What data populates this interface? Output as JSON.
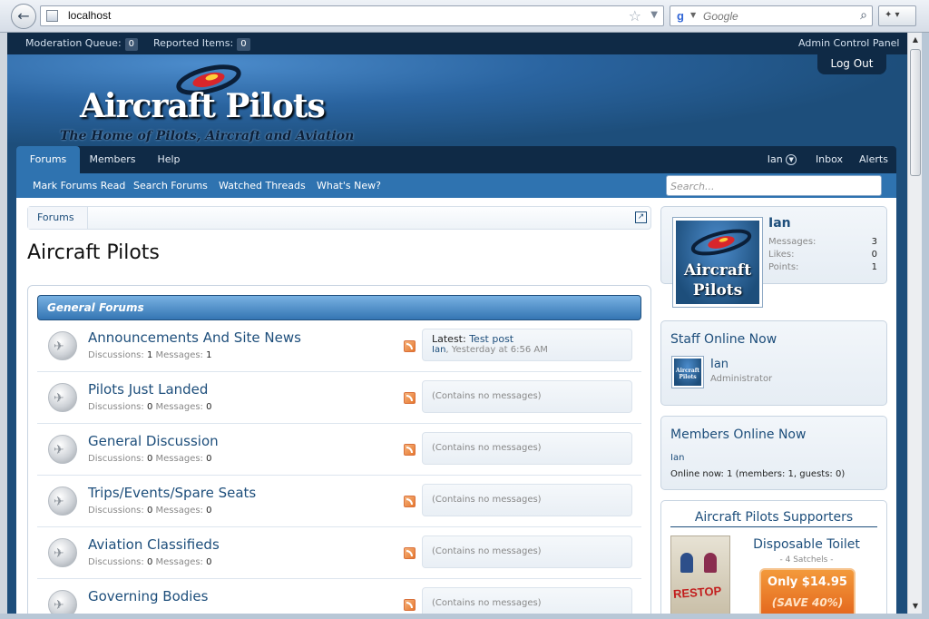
{
  "browser": {
    "url": "localhost",
    "search_placeholder": "Google"
  },
  "admin_bar": {
    "moderation_label": "Moderation Queue:",
    "moderation_count": "0",
    "reported_label": "Reported Items:",
    "reported_count": "0",
    "acp_label": "Admin Control Panel"
  },
  "header": {
    "logout_label": "Log Out",
    "logo_text": "Aircraft Pilots",
    "tagline": "The Home of Pilots, Aircraft and Aviation"
  },
  "nav": {
    "tabs": [
      {
        "label": "Forums",
        "active": true
      },
      {
        "label": "Members"
      },
      {
        "label": "Help"
      }
    ],
    "user": "Ian",
    "inbox": "Inbox",
    "alerts": "Alerts"
  },
  "subnav": {
    "links": [
      "Mark Forums Read",
      "Search Forums",
      "Watched Threads",
      "What's New?"
    ],
    "search_placeholder": "Search..."
  },
  "breadcrumb": {
    "item": "Forums"
  },
  "page_title": "Aircraft Pilots",
  "category": {
    "title": "General Forums"
  },
  "stats_labels": {
    "discussions": "Discussions:",
    "messages": "Messages:"
  },
  "forums": [
    {
      "title": "Announcements And Site News",
      "discussions": "1",
      "messages": "1",
      "latest_label": "Latest:",
      "latest_title": "Test post",
      "latest_user": "Ian",
      "latest_time": ", Yesterday at 6:56 AM"
    },
    {
      "title": "Pilots Just Landed",
      "discussions": "0",
      "messages": "0",
      "empty": "(Contains no messages)"
    },
    {
      "title": "General Discussion",
      "discussions": "0",
      "messages": "0",
      "empty": "(Contains no messages)"
    },
    {
      "title": "Trips/Events/Spare Seats",
      "discussions": "0",
      "messages": "0",
      "empty": "(Contains no messages)"
    },
    {
      "title": "Aviation Classifieds",
      "discussions": "0",
      "messages": "0",
      "empty": "(Contains no messages)"
    },
    {
      "title": "Governing Bodies",
      "empty": "(Contains no messages)"
    }
  ],
  "sidebar": {
    "visitor": {
      "avatar_text": "Aircraft Pilots",
      "name": "Ian",
      "stats": [
        {
          "label": "Messages:",
          "value": "3"
        },
        {
          "label": "Likes:",
          "value": "0"
        },
        {
          "label": "Points:",
          "value": "1"
        }
      ]
    },
    "staff": {
      "title": "Staff Online Now",
      "avatar_text": "Aircraft Pilots",
      "name": "Ian",
      "role": "Administrator"
    },
    "members": {
      "title": "Members Online Now",
      "member": "Ian",
      "online": "Online now: 1 (members: 1, guests: 0)"
    },
    "supporters": {
      "title": "Aircraft Pilots Supporters",
      "product": "Disposable Toilet",
      "qty": "- 4 Satchels -",
      "price": "Only $14.95",
      "save": "(SAVE 40%)",
      "img_text": "RESTOP"
    }
  }
}
